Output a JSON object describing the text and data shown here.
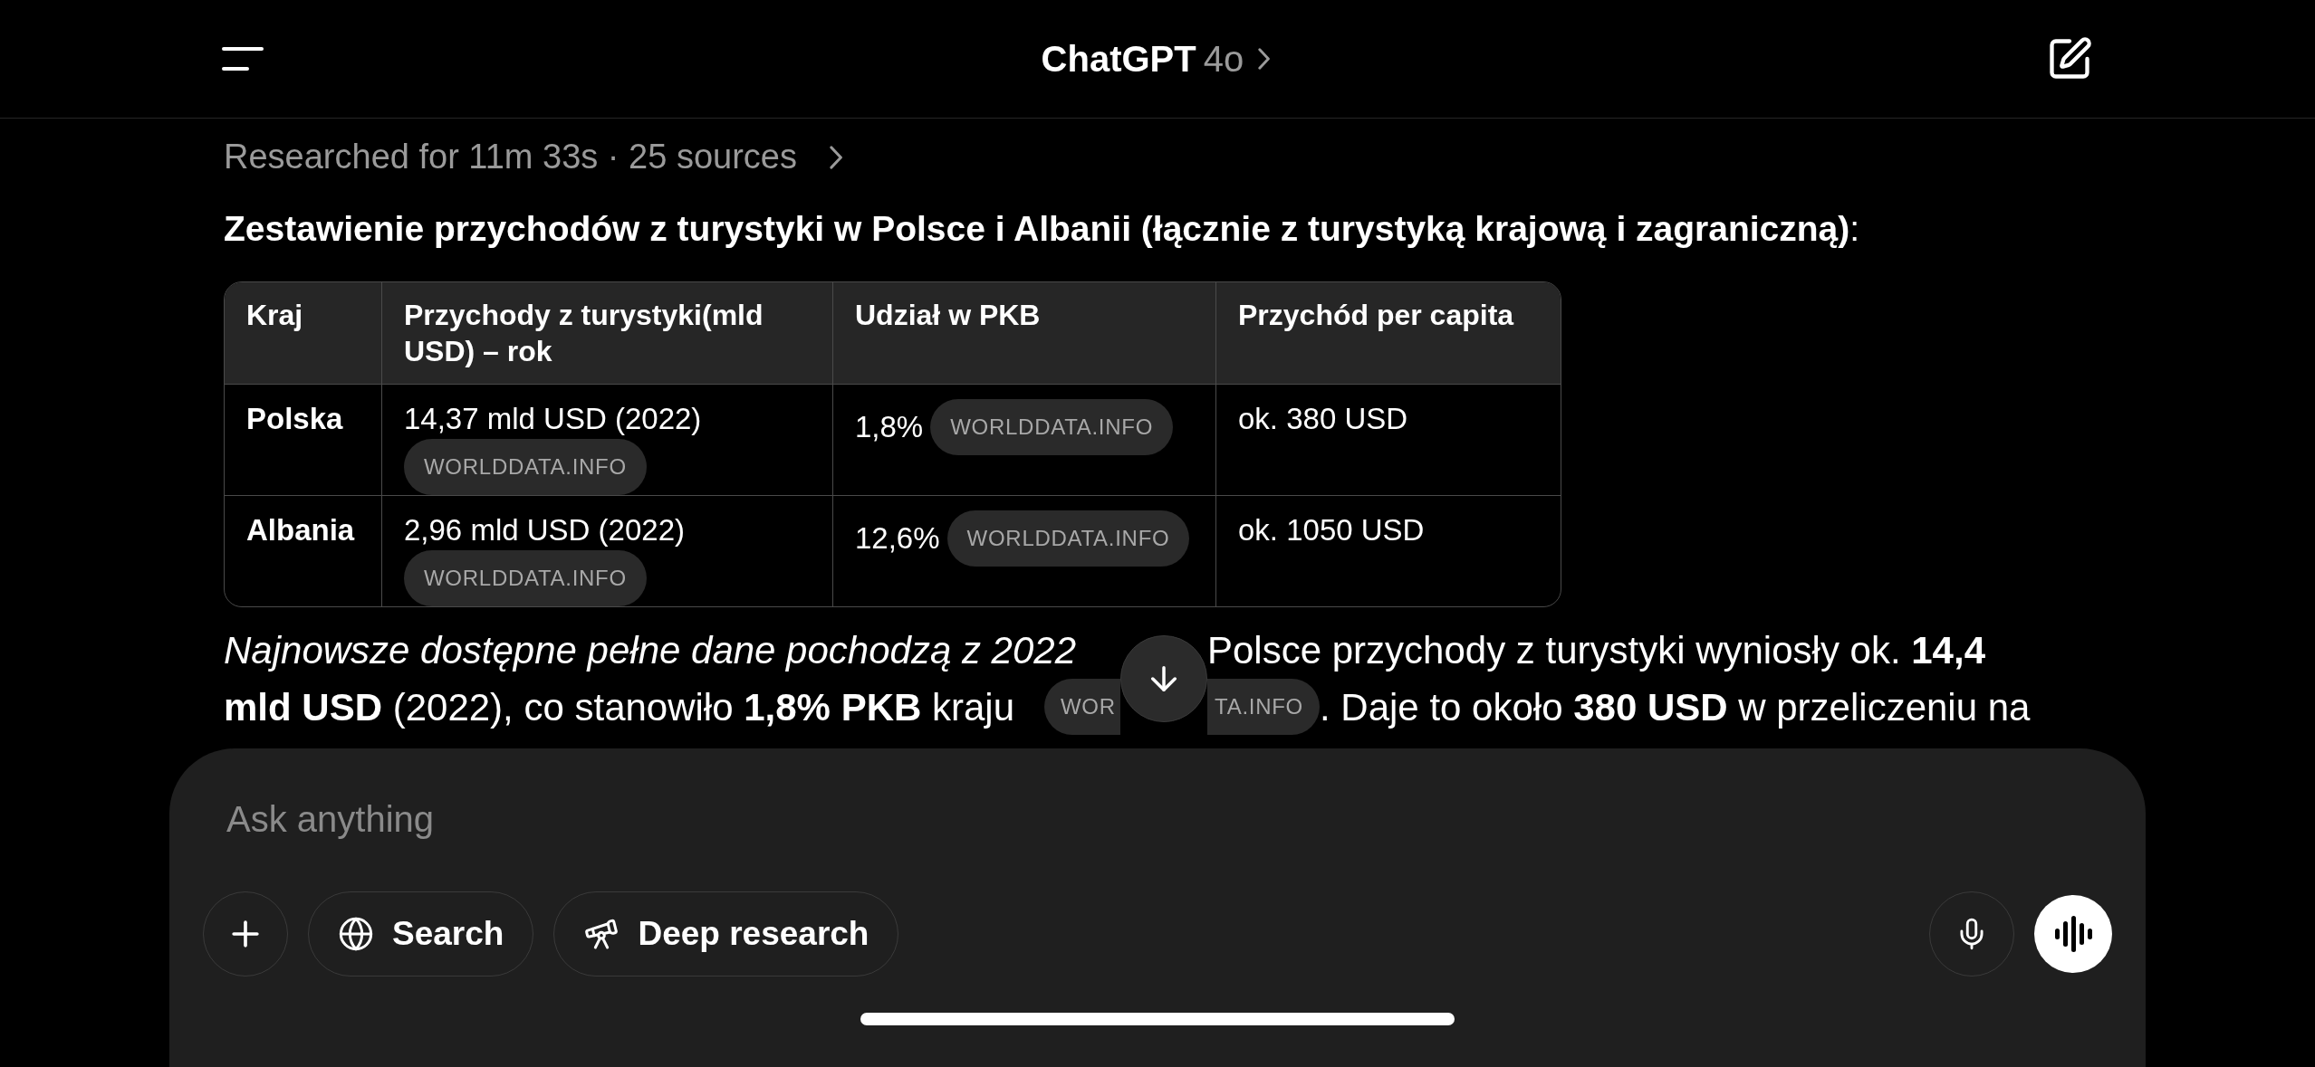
{
  "header": {
    "title": "ChatGPT",
    "model": "4o"
  },
  "research_summary": "Researched for 11m 33s · 25 sources",
  "heading": "**Zestawienie przychodów z turystyki w Polsce i Albanii (łącznie z turystyką krajową i zagraniczną)**:",
  "table": {
    "columns": [
      "Kraj",
      "Przychody z turystyki(mld USD) – rok",
      "Udział w PKB",
      "Przychód per capita"
    ],
    "rows": [
      {
        "cells": [
          {
            "text": "Polska"
          },
          {
            "text": "14,37 mld USD (2022)",
            "source": "WORLDDATA.INFO"
          },
          {
            "text": "1,8%",
            "source": "WORLDDATA.INFO"
          },
          {
            "text": "ok. 380 USD"
          }
        ]
      },
      {
        "cells": [
          {
            "text": "Albania"
          },
          {
            "text": "2,96 mld USD (2022)",
            "source": "WORLDDATA.INFO"
          },
          {
            "text": "12,6%",
            "source": "WORLDDATA.INFO"
          },
          {
            "text": "ok. 1050 USD"
          }
        ]
      }
    ]
  },
  "paragraph": {
    "line_1_start": "Najnowsze dostępne pełne dane pochodzą z 2022",
    "line_1_end": "Polsce przychody z turystyki wyniosły ok. **14,4**",
    "line_2_start": "**mld USD** (2022), co stanowiło **1,8% PKB** kraju",
    "source_start": "WOR",
    "source_end": "TA.INFO",
    "line_2_end": ". Daje to około **380 USD** w przeliczeniu na"
  },
  "composer": {
    "placeholder": "Ask anything",
    "tools": [
      {
        "label": "Search",
        "kind": "globe"
      },
      {
        "label": "Deep research",
        "kind": "telescope"
      }
    ]
  }
}
